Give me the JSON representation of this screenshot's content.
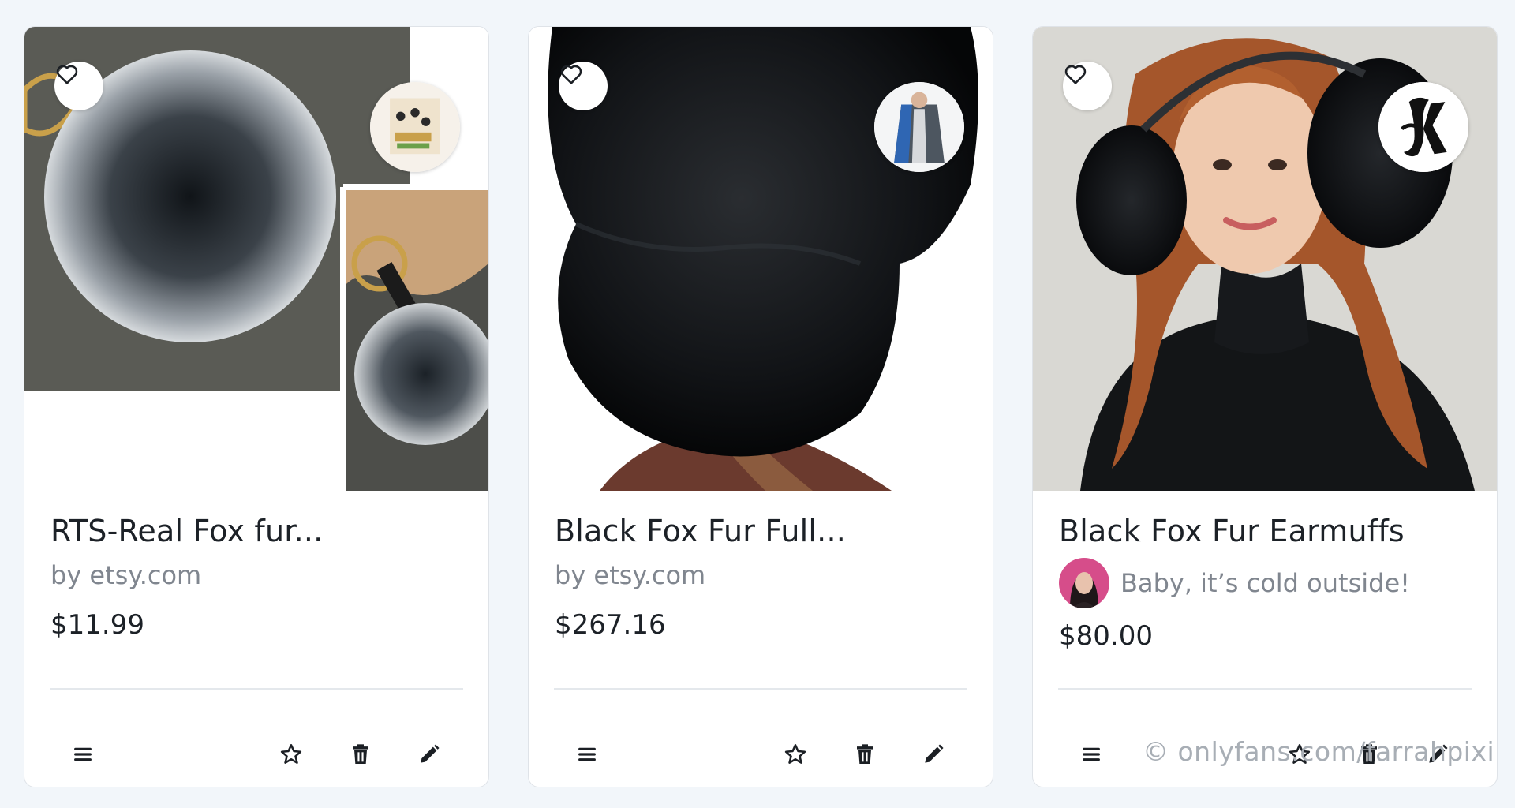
{
  "cards": [
    {
      "title": "RTS-Real Fox fur...",
      "byline": "by etsy.com",
      "price": "$11.99",
      "image_icon": "fox-fur-pompom-keychain-image",
      "badge_icon": "store-logo-avatar"
    },
    {
      "title": "Black Fox Fur Full...",
      "byline": "by etsy.com",
      "price": "$267.16",
      "image_icon": "black-fox-fur-hat-image",
      "badge_icon": "store-logo-avatar"
    },
    {
      "title": "Black Fox Fur Earmuffs",
      "collection": "Baby, it’s cold outside!",
      "price": "$80.00",
      "image_icon": "woman-wearing-fur-earmuffs-image",
      "badge_icon": "store-logo-avatar"
    }
  ],
  "actions": [
    "menu-icon",
    "star-icon",
    "trash-icon",
    "pencil-icon"
  ],
  "watermark": "© onlyfans.com/farrahpixi",
  "colors": {
    "background": "#f2f6fa",
    "card": "#ffffff",
    "muted_text": "#80868f"
  }
}
